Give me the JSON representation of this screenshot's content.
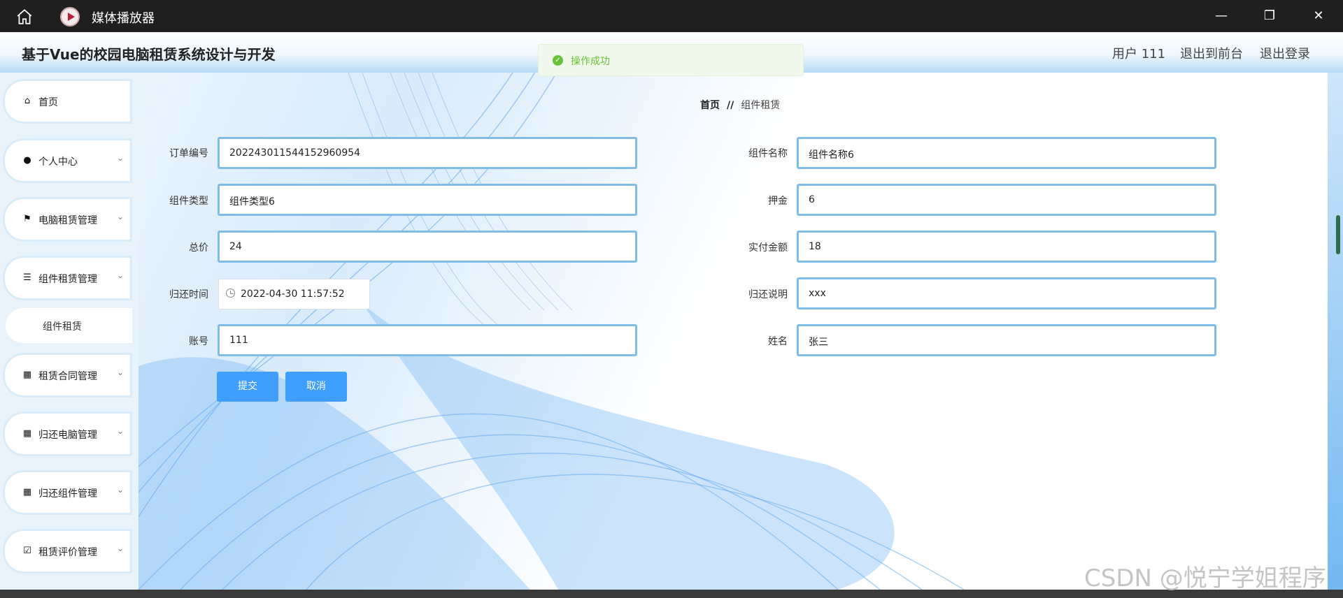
{
  "window": {
    "title": "媒体播放器",
    "controls": [
      "minimize-icon",
      "restore-icon",
      "close-icon"
    ]
  },
  "header": {
    "app_title": "基于Vue的校园电脑租赁系统设计与开发",
    "user_label": "用户 111",
    "front_link": "退出到前台",
    "logout_link": "退出登录"
  },
  "toast": {
    "text": "操作成功",
    "color": "#67c23a"
  },
  "sidebar": {
    "items": [
      {
        "label": "首页",
        "icon": "home-icon"
      },
      {
        "label": "个人中心",
        "icon": "user-icon"
      },
      {
        "label": "电脑租赁管理",
        "icon": "flag-icon"
      },
      {
        "label": "组件租赁管理",
        "icon": "list-icon"
      },
      {
        "label": "租赁合同管理",
        "icon": "grid-icon"
      },
      {
        "label": "归还电脑管理",
        "icon": "grid-icon"
      },
      {
        "label": "归还组件管理",
        "icon": "clipboard-icon"
      },
      {
        "label": "租赁评价管理",
        "icon": "clipboard-check-icon"
      }
    ],
    "sub_item": "组件租赁"
  },
  "breadcrumb": {
    "home": "首页",
    "separator": "//",
    "current": "组件租赁"
  },
  "form": {
    "order_no": {
      "label": "订单编号",
      "value": "202243011544152960954"
    },
    "component_name": {
      "label": "组件名称",
      "value": "组件名称6"
    },
    "component_type": {
      "label": "组件类型",
      "value": "组件类型6"
    },
    "deposit": {
      "label": "押金",
      "value": "6"
    },
    "total_price": {
      "label": "总价",
      "value": "24"
    },
    "paid_amount": {
      "label": "实付金额",
      "value": "18"
    },
    "return_time": {
      "label": "归还时间",
      "value": "2022-04-30 11:57:52"
    },
    "return_note": {
      "label": "归还说明",
      "value": "xxx"
    },
    "account": {
      "label": "账号",
      "value": "111"
    },
    "name": {
      "label": "姓名",
      "value": "张三"
    },
    "submit_label": "提交",
    "cancel_label": "取消"
  },
  "watermark": "CSDN @悦宁学姐程序",
  "colors": {
    "accent": "#409eff",
    "field_border": "#7fbde6",
    "titlebar": "#1f1f1f"
  }
}
